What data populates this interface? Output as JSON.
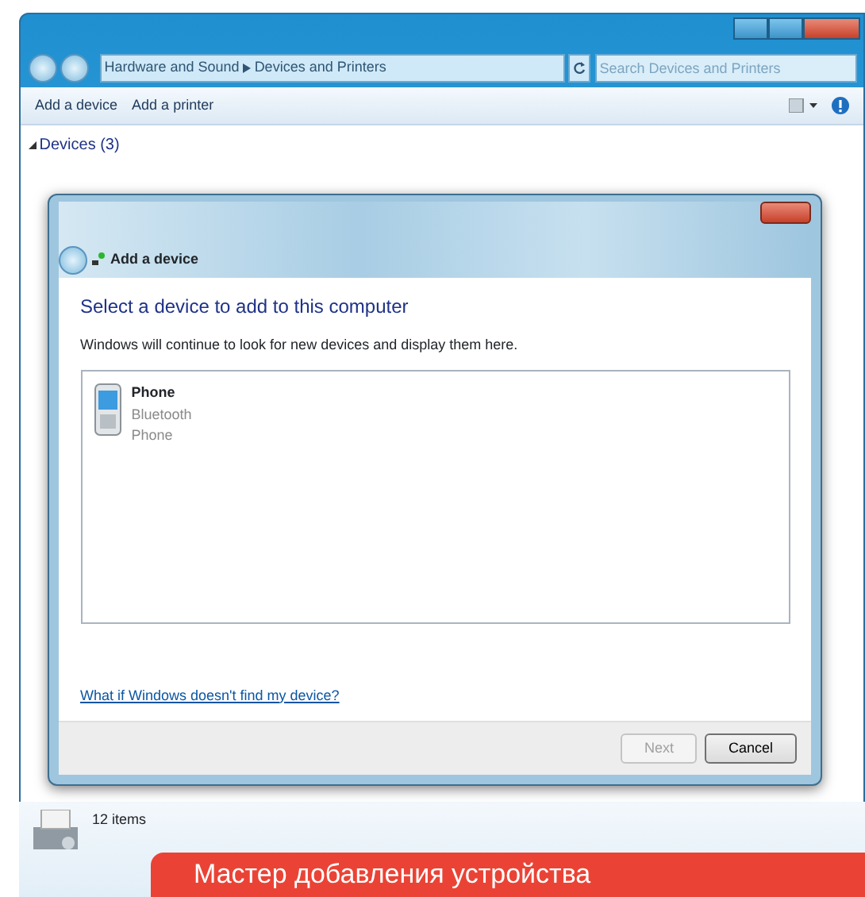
{
  "explorer": {
    "breadcrumb": [
      "Hardware and Sound",
      "Devices and Printers"
    ],
    "search": {
      "placeholder": "Search Devices and Printers"
    },
    "toolbar": [
      "Add a device",
      "Add a printer"
    ],
    "group": "Devices (3)",
    "status": "12 items"
  },
  "dialog": {
    "title": "Add a device",
    "heading": "Select a device to add to this computer",
    "description": "Windows will continue to look for new devices and display them here.",
    "devices": [
      {
        "name": "Phone",
        "connection": "Bluetooth",
        "category": "Phone",
        "selected": false
      }
    ],
    "help_link": "What if Windows doesn't find my device?",
    "buttons": [
      {
        "label": "Next",
        "disabled": true
      },
      {
        "label": "Cancel",
        "disabled": false
      }
    ]
  },
  "caption": "Мастер добавления устройства"
}
